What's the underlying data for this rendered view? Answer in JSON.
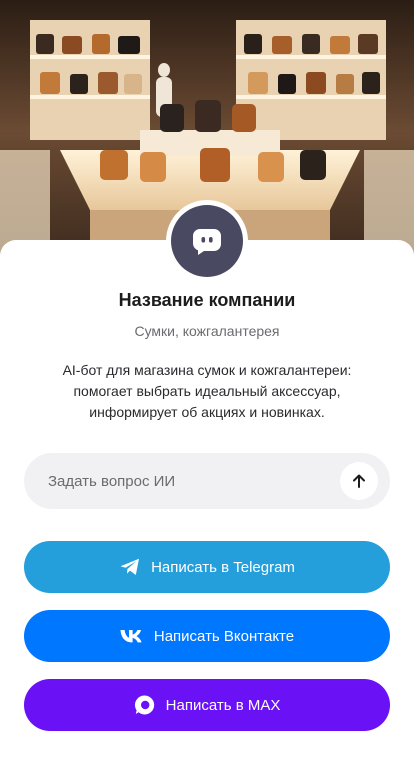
{
  "company": {
    "name": "Название компании",
    "category": "Сумки, кожгалантерея",
    "description": "AI-бот для магазина сумок и кожгалантереи: помогает выбрать идеальный аксессуар, информирует об акциях и новинках."
  },
  "ask": {
    "placeholder": "Задать вопрос ИИ"
  },
  "buttons": {
    "telegram": {
      "label": "Написать в Telegram",
      "color": "#259fdb",
      "icon": "telegram-icon"
    },
    "vk": {
      "label": "Написать Вконтакте",
      "color": "#0077ff",
      "icon": "vk-icon"
    },
    "max": {
      "label": "Написать в MAX",
      "color": "#6a11f6",
      "icon": "max-icon"
    }
  },
  "colors": {
    "avatar": "#494962",
    "ask_background": "#f1f1f3"
  }
}
